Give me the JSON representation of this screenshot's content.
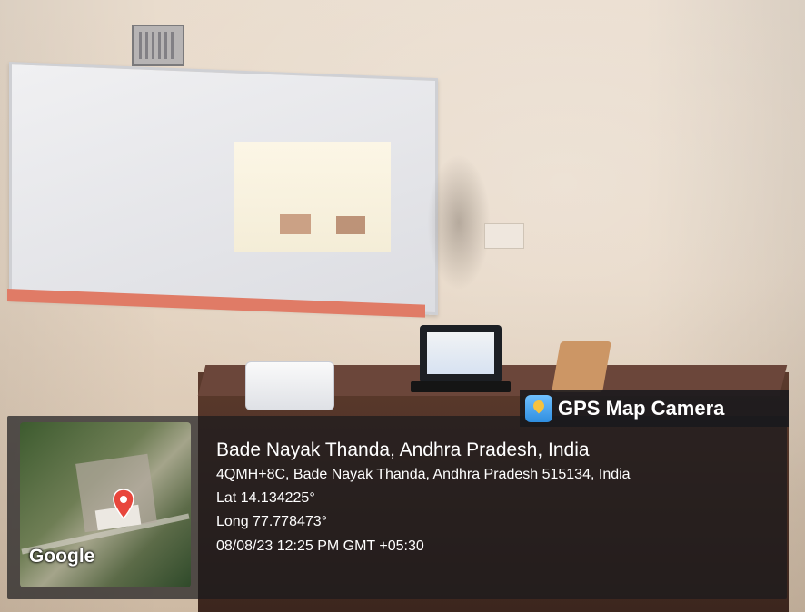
{
  "overlay": {
    "brand": {
      "icon": "map-pin-app-icon",
      "label": "GPS Map Camera"
    },
    "map": {
      "attribution": "Google",
      "pin_icon": "location-pin-icon"
    },
    "place_name": "Bade Nayak Thanda, Andhra Pradesh, India",
    "address": "4QMH+8C, Bade Nayak Thanda, Andhra Pradesh 515134, India",
    "latitude": "Lat 14.134225°",
    "longitude": "Long 77.778473°",
    "timestamp": "08/08/23 12:25 PM GMT +05:30"
  },
  "colors": {
    "overlay_bg": "#1c1c1f",
    "pin": "#e8463c",
    "text": "#ffffff"
  }
}
